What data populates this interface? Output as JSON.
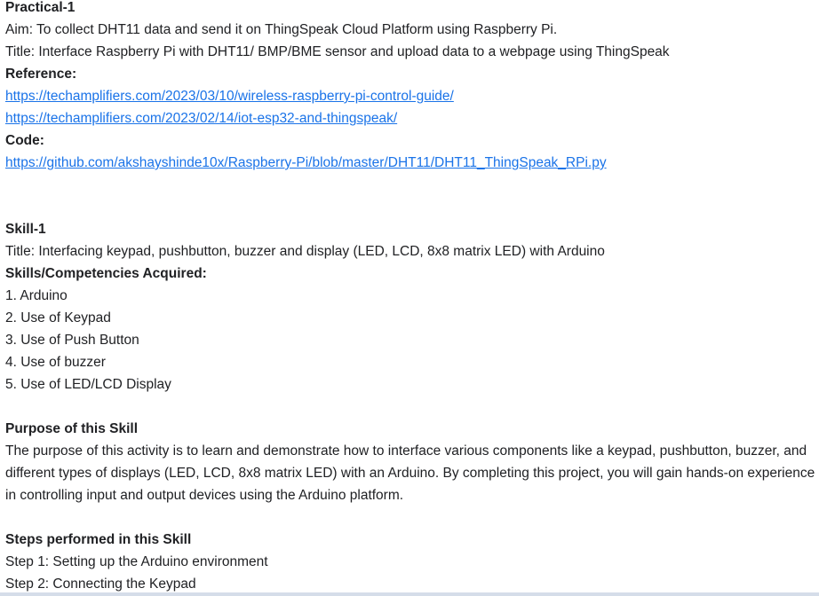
{
  "practical": {
    "heading": "Practical-1",
    "aim": "Aim: To collect DHT11 data and send it on ThingSpeak Cloud Platform using Raspberry Pi.",
    "title": "Title: Interface Raspberry Pi with DHT11/ BMP/BME sensor and upload data to a webpage using ThingSpeak",
    "reference_label": "Reference:",
    "references": [
      "https://techamplifiers.com/2023/03/10/wireless-raspberry-pi-control-guide/",
      "https://techamplifiers.com/2023/02/14/iot-esp32-and-thingspeak/"
    ],
    "code_label": "Code:",
    "code_link": "https://github.com/akshayshinde10x/Raspberry-Pi/blob/master/DHT11/DHT11_ThingSpeak_RPi.py"
  },
  "skill": {
    "heading": "Skill-1",
    "title": "Title: Interfacing keypad, pushbutton, buzzer and display (LED, LCD, 8x8 matrix LED) with Arduino",
    "competencies_label": "Skills/Competencies Acquired:",
    "competencies": [
      "1. Arduino",
      "2. Use of Keypad",
      "3. Use of Push Button",
      "4. Use of buzzer",
      "5. Use of LED/LCD Display"
    ],
    "purpose_heading": "Purpose of this Skill",
    "purpose_text": "The purpose of this activity is to learn and demonstrate how to interface various components like a keypad, pushbutton, buzzer, and different types of displays (LED, LCD, 8x8 matrix LED) with an Arduino. By completing this project, you will gain hands-on experience in controlling input and output devices using the Arduino platform.",
    "steps_heading": "Steps performed in this Skill",
    "steps": [
      "Step 1: Setting up the Arduino environment",
      "Step 2: Connecting the Keypad"
    ]
  }
}
